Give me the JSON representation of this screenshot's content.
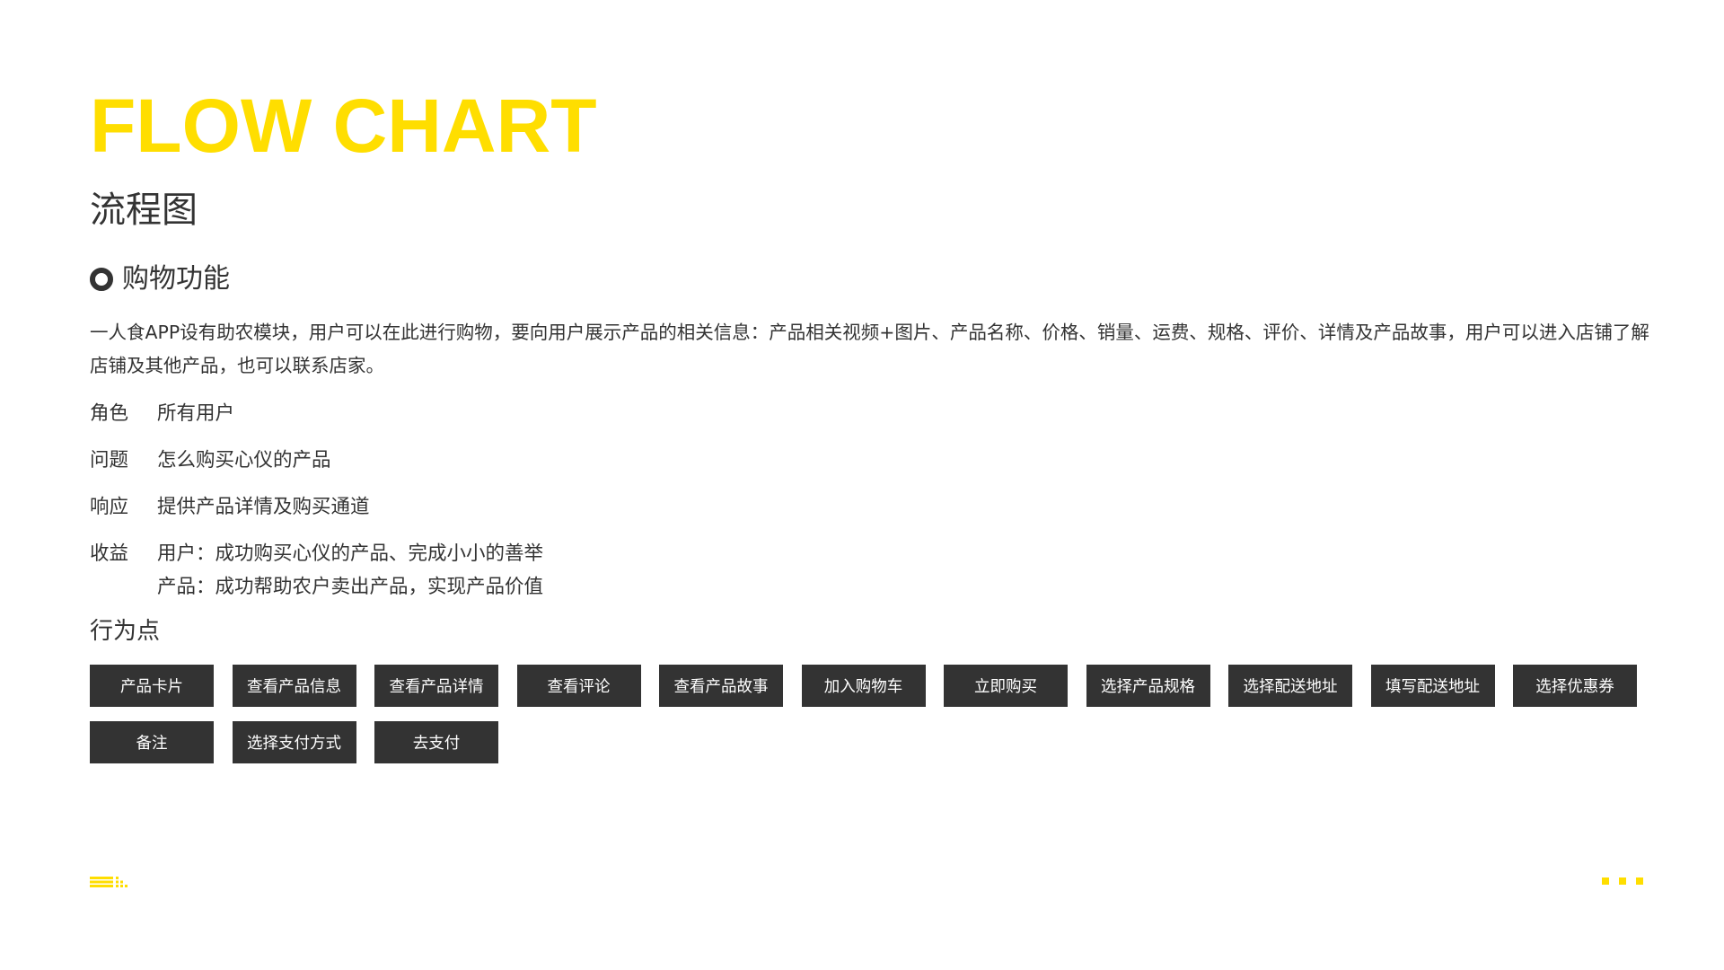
{
  "header": {
    "title": "FLOW CHART",
    "subtitle": "流程图"
  },
  "section": {
    "title": "购物功能",
    "description": "一人食APP设有助农模块，用户可以在此进行购物，要向用户展示产品的相关信息：产品相关视频+图片、产品名称、价格、销量、运费、规格、评价、详情及产品故事，用户可以进入店铺了解店铺及其他产品，也可以联系店家。"
  },
  "info": [
    {
      "label": "角色",
      "values": [
        "所有用户"
      ]
    },
    {
      "label": "问题",
      "values": [
        "怎么购买心仪的产品"
      ]
    },
    {
      "label": "响应",
      "values": [
        "提供产品详情及购买通道"
      ]
    },
    {
      "label": "收益",
      "values": [
        "用户：成功购买心仪的产品、完成小小的善举",
        "产品：成功帮助农户卖出产品，实现产品价值"
      ]
    }
  ],
  "behavior": {
    "title": "行为点",
    "items": [
      "产品卡片",
      "查看产品信息",
      "查看产品详情",
      "查看评论",
      "查看产品故事",
      "加入购物车",
      "立即购买",
      "选择产品规格",
      "选择配送地址",
      "填写配送地址",
      "选择优惠券",
      "备注",
      "选择支付方式",
      "去支付"
    ]
  },
  "colors": {
    "accent": "#ffde00",
    "text": "#333333",
    "chip_bg": "#333333",
    "chip_text": "#ffffff"
  },
  "icons": {
    "section_marker": "ring-icon",
    "footer_left": "logo-mark-icon",
    "footer_right": "dots-icon"
  }
}
